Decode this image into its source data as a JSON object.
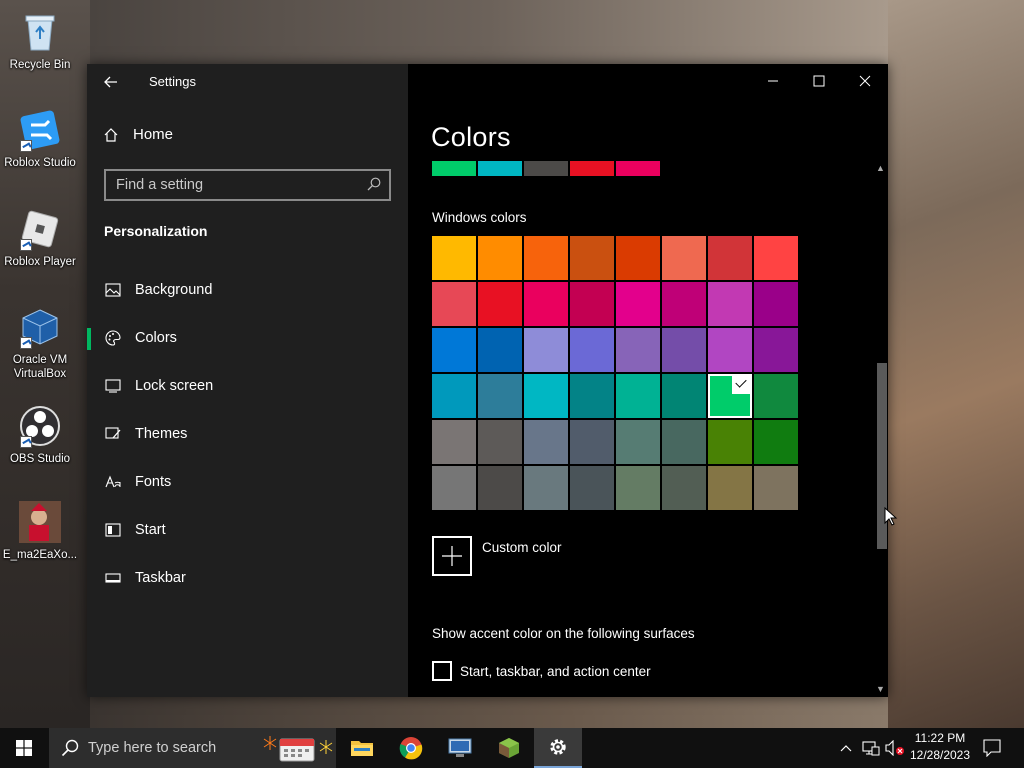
{
  "desktop": {
    "icons": [
      {
        "label": "Recycle Bin",
        "icon": "recycle-bin-icon"
      },
      {
        "label": "Roblox Studio",
        "icon": "roblox-studio-icon"
      },
      {
        "label": "Roblox Player",
        "icon": "roblox-player-icon"
      },
      {
        "label": "Oracle VM VirtualBox",
        "icon": "virtualbox-icon"
      },
      {
        "label": "OBS Studio",
        "icon": "obs-icon"
      },
      {
        "label": "E_ma2EaXo...",
        "icon": "image-file-icon"
      }
    ]
  },
  "window": {
    "title": "Settings",
    "controls": {
      "minimize": "minimize",
      "maximize": "maximize",
      "close": "close"
    }
  },
  "sidebar": {
    "home_label": "Home",
    "search_placeholder": "Find a setting",
    "section_title": "Personalization",
    "items": [
      {
        "label": "Background",
        "icon": "image-icon",
        "active": false
      },
      {
        "label": "Colors",
        "icon": "palette-icon",
        "active": true
      },
      {
        "label": "Lock screen",
        "icon": "lock-screen-icon",
        "active": false
      },
      {
        "label": "Themes",
        "icon": "brush-icon",
        "active": false
      },
      {
        "label": "Fonts",
        "icon": "font-icon",
        "active": false
      },
      {
        "label": "Start",
        "icon": "start-icon",
        "active": false
      },
      {
        "label": "Taskbar",
        "icon": "taskbar-icon",
        "active": false
      }
    ],
    "accent_indicator_color": "#00b760"
  },
  "main": {
    "page_title": "Colors",
    "recent_colors": [
      "#00cc6a",
      "#00b7c3",
      "#4c4a48",
      "#e81123",
      "#ea005e"
    ],
    "windows_colors_label": "Windows colors",
    "windows_colors": [
      [
        "#ffb900",
        "#ff8c00",
        "#f7630c",
        "#ca5010",
        "#da3b01",
        "#ef6950",
        "#d13438",
        "#ff4343"
      ],
      [
        "#e74856",
        "#e81123",
        "#ea005e",
        "#c30052",
        "#e3008c",
        "#bf0077",
        "#c239b3",
        "#9a0089"
      ],
      [
        "#0078d7",
        "#0063b1",
        "#8e8cd8",
        "#6b69d6",
        "#8764b8",
        "#744da9",
        "#b146c2",
        "#881798"
      ],
      [
        "#0099bc",
        "#2d7d9a",
        "#00b7c3",
        "#038387",
        "#00b294",
        "#018574",
        "#00cc6a",
        "#10893e"
      ],
      [
        "#7a7574",
        "#5d5a58",
        "#68768a",
        "#515c6b",
        "#567c73",
        "#486860",
        "#498205",
        "#107c10"
      ],
      [
        "#767676",
        "#4c4a48",
        "#69797e",
        "#4a5459",
        "#647c64",
        "#525e54",
        "#847545",
        "#7e735f"
      ]
    ],
    "selected_color": "#00cc6a",
    "custom_color_label": "Custom color",
    "accent_surfaces_label": "Show accent color on the following surfaces",
    "checkbox_label": "Start, taskbar, and action center",
    "checkbox_checked": false
  },
  "taskbar": {
    "search_placeholder": "Type here to search",
    "apps": [
      {
        "name": "File Explorer",
        "icon": "folder-icon"
      },
      {
        "name": "Google Chrome",
        "icon": "chrome-icon"
      },
      {
        "name": "Remote Desktop",
        "icon": "remote-desktop-icon"
      },
      {
        "name": "Minecraft",
        "icon": "minecraft-icon"
      },
      {
        "name": "Settings",
        "icon": "gear-icon",
        "active": true
      }
    ],
    "time": "11:22 PM",
    "date": "12/28/2023"
  }
}
